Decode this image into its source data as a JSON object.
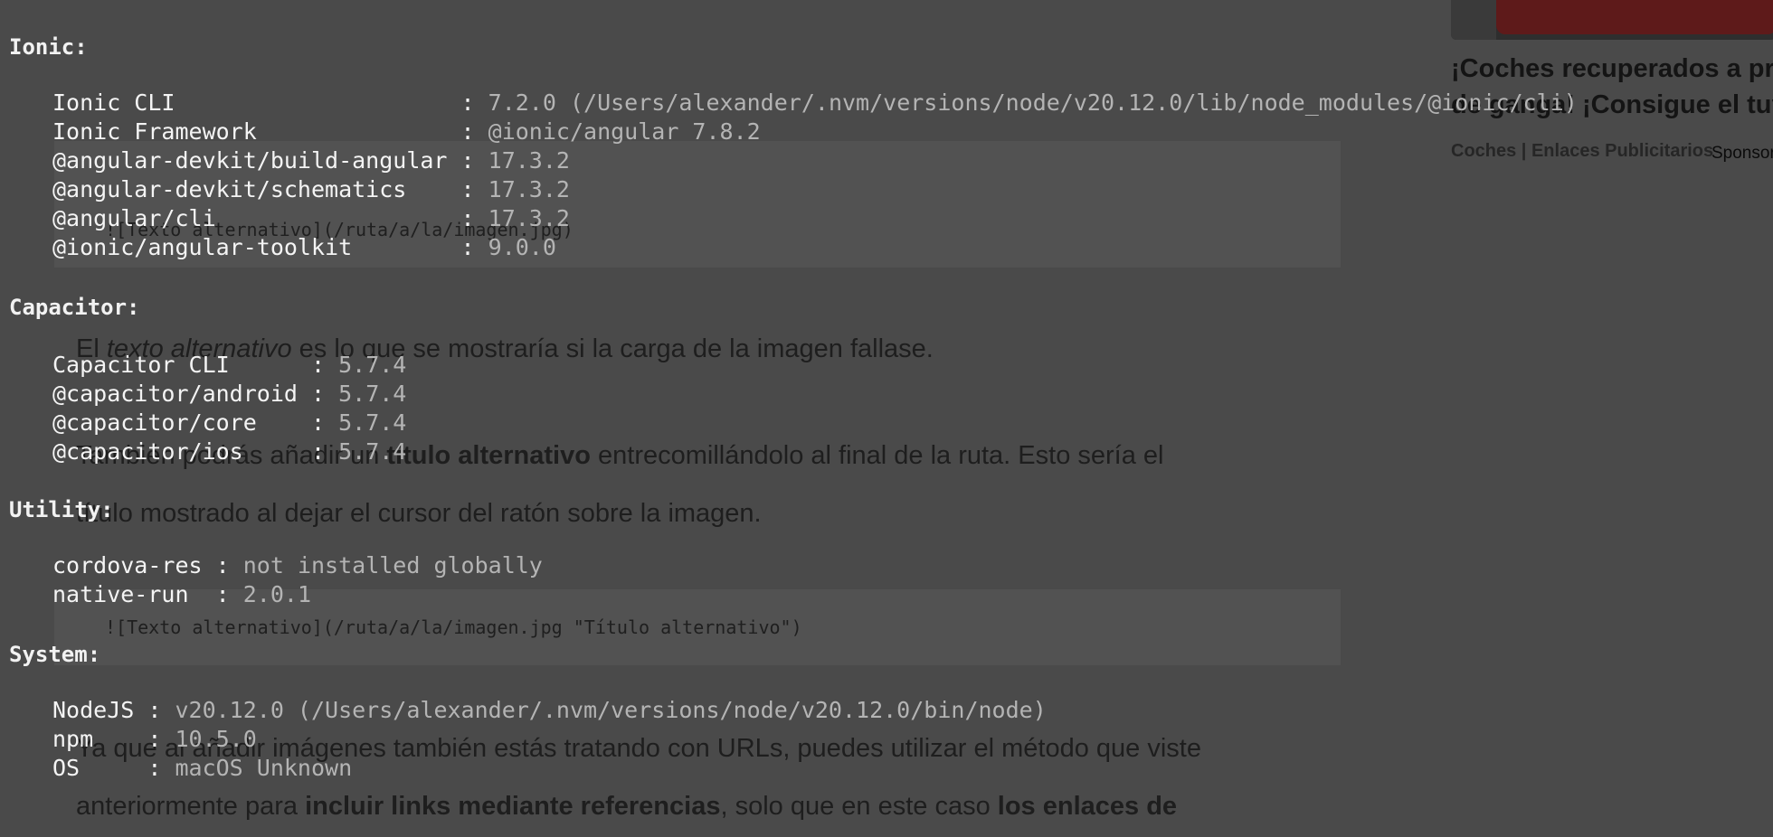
{
  "background_page": {
    "code_blocks": [
      {
        "text": "![Texto alternativo](/ruta/a/la/imagen.jpg)"
      },
      {
        "text": "![Texto alternativo](/ruta/a/la/imagen.jpg \"Título alternativo\")"
      }
    ],
    "paragraphs": [
      {
        "before": "El ",
        "em": "texto alternativo",
        "after": " es lo que se mostraría si la carga de la imagen fallase."
      },
      {
        "before": "También podrás añadir un ",
        "strong": "título alternativo",
        "after": " entrecomillándolo al final de la ruta. Esto sería el"
      },
      {
        "text": "título mostrado al dejar el cursor del ratón sobre la imagen."
      },
      {
        "text": "Ya que al añadir imágenes también estás tratando con URLs, puedes utilizar el método que viste"
      },
      {
        "before": "anteriormente para ",
        "strong": "incluir links mediante referencias",
        "middle": ", solo que en este caso ",
        "strong2": "los enlaces de"
      }
    ],
    "sidebar_ad": {
      "title": "¡Coches recuperados a precio de ganga! ¡Consigue el tuyo!",
      "source": "Coches | Enlaces Publicitarios",
      "sponsor": "Sponsored"
    }
  },
  "terminal": {
    "sections": [
      {
        "heading": "Ionic:",
        "rows": [
          {
            "key": "Ionic CLI                     ",
            "value": "7.2.0 (/Users/alexander/.nvm/versions/node/v20.12.0/lib/node_modules/@ionic/cli)"
          },
          {
            "key": "Ionic Framework               ",
            "value": "@ionic/angular 7.8.2"
          },
          {
            "key": "@angular-devkit/build-angular ",
            "value": "17.3.2"
          },
          {
            "key": "@angular-devkit/schematics    ",
            "value": "17.3.2"
          },
          {
            "key": "@angular/cli                  ",
            "value": "17.3.2"
          },
          {
            "key": "@ionic/angular-toolkit        ",
            "value": "9.0.0"
          }
        ]
      },
      {
        "heading": "Capacitor:",
        "rows": [
          {
            "key": "Capacitor CLI      ",
            "value": "5.7.4"
          },
          {
            "key": "@capacitor/android ",
            "value": "5.7.4"
          },
          {
            "key": "@capacitor/core    ",
            "value": "5.7.4"
          },
          {
            "key": "@capacitor/ios     ",
            "value": "5.7.4"
          }
        ]
      },
      {
        "heading": "Utility:",
        "rows": [
          {
            "key": "cordova-res ",
            "value": "not installed globally"
          },
          {
            "key": "native-run  ",
            "value": "2.0.1"
          }
        ]
      },
      {
        "heading": "System:",
        "rows": [
          {
            "key": "NodeJS ",
            "value": "v20.12.0 (/Users/alexander/.nvm/versions/node/v20.12.0/bin/node)"
          },
          {
            "key": "npm    ",
            "value": "10.5.0"
          },
          {
            "key": "OS     ",
            "value": "macOS Unknown"
          }
        ]
      }
    ],
    "separator": ": "
  },
  "colors": {
    "background": "#4a4a4a",
    "terminal_key": "#f4f4f4",
    "terminal_value": "#b4b4b4",
    "page_text": "#1e1e1e"
  }
}
